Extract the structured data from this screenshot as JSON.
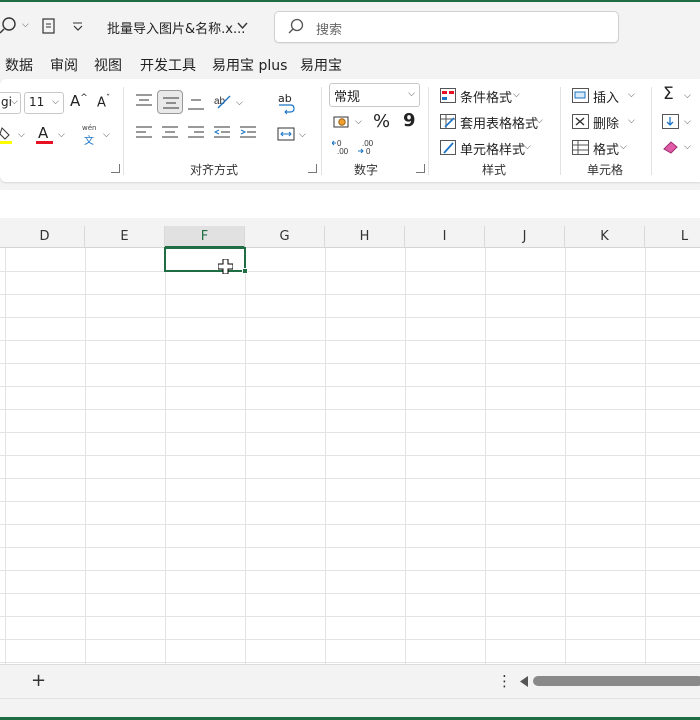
{
  "titlebar": {
    "doc_title": "批量导入图片&名称.x...",
    "search_placeholder": "搜索"
  },
  "menu": [
    "数据",
    "审阅",
    "视图",
    "开发工具",
    "易用宝 plus",
    "易用宝"
  ],
  "ribbon": {
    "font_size": "11",
    "grow_font": "A",
    "shrink_font": "A",
    "font_color_letter": "A",
    "phonetic_top": "wén",
    "phonetic_bottom": "文",
    "wrap_text_top": "ab",
    "number_format": "常规",
    "percent": "%",
    "comma": "9",
    "conditional_format": "条件格式",
    "table_format": "套用表格格式",
    "cell_styles": "单元格样式",
    "insert": "插入",
    "delete": "删除",
    "format": "格式",
    "sum_symbol": "Σ",
    "groups": {
      "alignment": "对齐方式",
      "number": "数字",
      "styles": "样式",
      "cells": "单元格"
    }
  },
  "grid": {
    "columns": [
      "D",
      "E",
      "F",
      "G",
      "H",
      "I",
      "J",
      "K",
      "L"
    ],
    "selected_column": "F"
  },
  "sheetbar": {
    "add_sheet": "+",
    "more": "⋮"
  },
  "colors": {
    "accent": "#1f6e43",
    "font_color_bar": "#e81123",
    "highlight_bar": "#ffff00"
  }
}
